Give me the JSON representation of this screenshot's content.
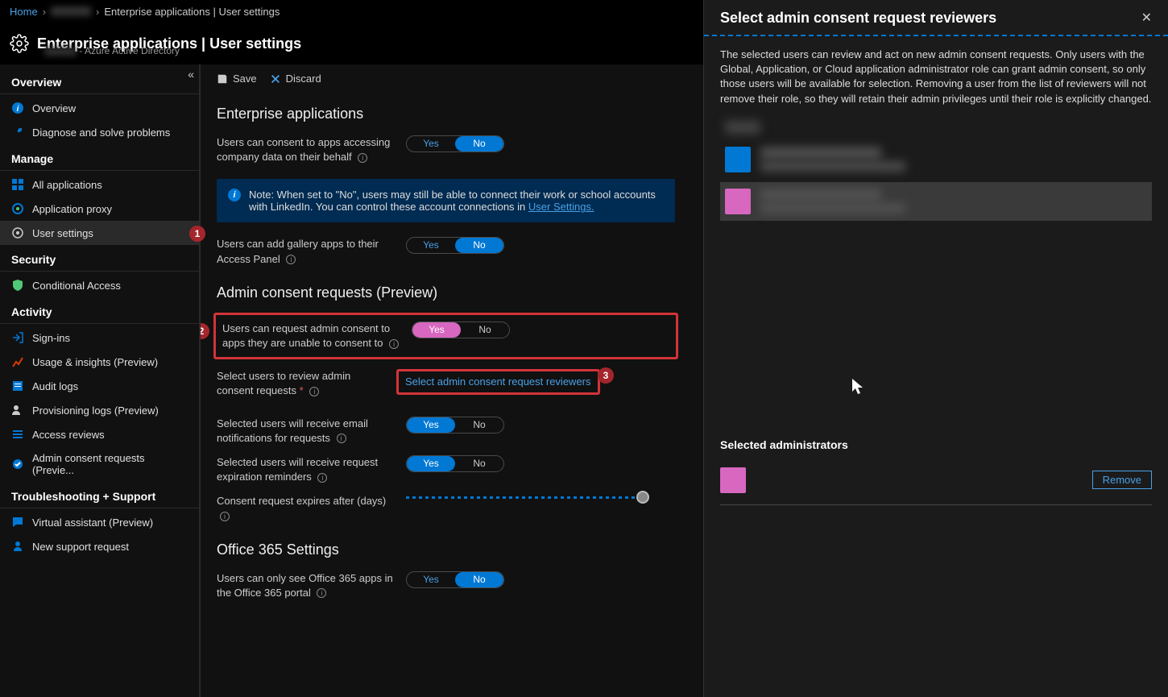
{
  "breadcrumb": {
    "home": "Home",
    "mid": "",
    "current": "Enterprise applications | User settings"
  },
  "header": {
    "title": "Enterprise applications | User settings",
    "subtitle": " - Azure Active Directory"
  },
  "sidebar": {
    "overview_title": "Overview",
    "items_overview": [
      {
        "label": "Overview"
      },
      {
        "label": "Diagnose and solve problems"
      }
    ],
    "manage_title": "Manage",
    "items_manage": [
      {
        "label": "All applications"
      },
      {
        "label": "Application proxy"
      },
      {
        "label": "User settings"
      }
    ],
    "security_title": "Security",
    "items_security": [
      {
        "label": "Conditional Access"
      }
    ],
    "activity_title": "Activity",
    "items_activity": [
      {
        "label": "Sign-ins"
      },
      {
        "label": "Usage & insights (Preview)"
      },
      {
        "label": "Audit logs"
      },
      {
        "label": "Provisioning logs (Preview)"
      },
      {
        "label": "Access reviews"
      },
      {
        "label": "Admin consent requests (Previe..."
      }
    ],
    "trouble_title": "Troubleshooting + Support",
    "items_trouble": [
      {
        "label": "Virtual assistant (Preview)"
      },
      {
        "label": "New support request"
      }
    ]
  },
  "toolbar": {
    "save": "Save",
    "discard": "Discard"
  },
  "sections": {
    "ent_apps": "Enterprise applications",
    "consent_company": "Users can consent to apps accessing company data on their behalf",
    "info_note": "Note: When set to \"No\", users may still be able to connect their work or school accounts with LinkedIn. You can control these account connections in ",
    "info_link": "User Settings.",
    "gallery": "Users can add gallery apps to their Access Panel",
    "admin_req": "Admin consent requests (Preview)",
    "user_request": "Users can request admin consent to apps they are unable to consent to",
    "select_review": "Select users to review admin consent requests",
    "select_link": "Select admin consent request reviewers",
    "email_notif": "Selected users will receive email notifications for requests",
    "exp_remind": "Selected users will receive request expiration reminders",
    "expires_after": "Consent request expires after (days)",
    "o365_title": "Office 365 Settings",
    "o365_only": "Users can only see Office 365 apps in the Office 365 portal"
  },
  "toggles": {
    "yes": "Yes",
    "no": "No"
  },
  "markers": {
    "m1": "1",
    "m2": "2",
    "m3": "3"
  },
  "panel": {
    "title": "Select admin consent request reviewers",
    "desc": "The selected users can review and act on new admin consent requests. Only users with the Global, Application, or Cloud application administrator role can grant admin consent, so only those users will be available for selection. Removing a user from the list of reviewers will not remove their role, so they will retain their admin privileges until their role is explicitly changed.",
    "selected_title": "Selected administrators",
    "remove": "Remove"
  },
  "colors": {
    "avatar1": "#0078d4",
    "avatar2": "#d867c0"
  }
}
